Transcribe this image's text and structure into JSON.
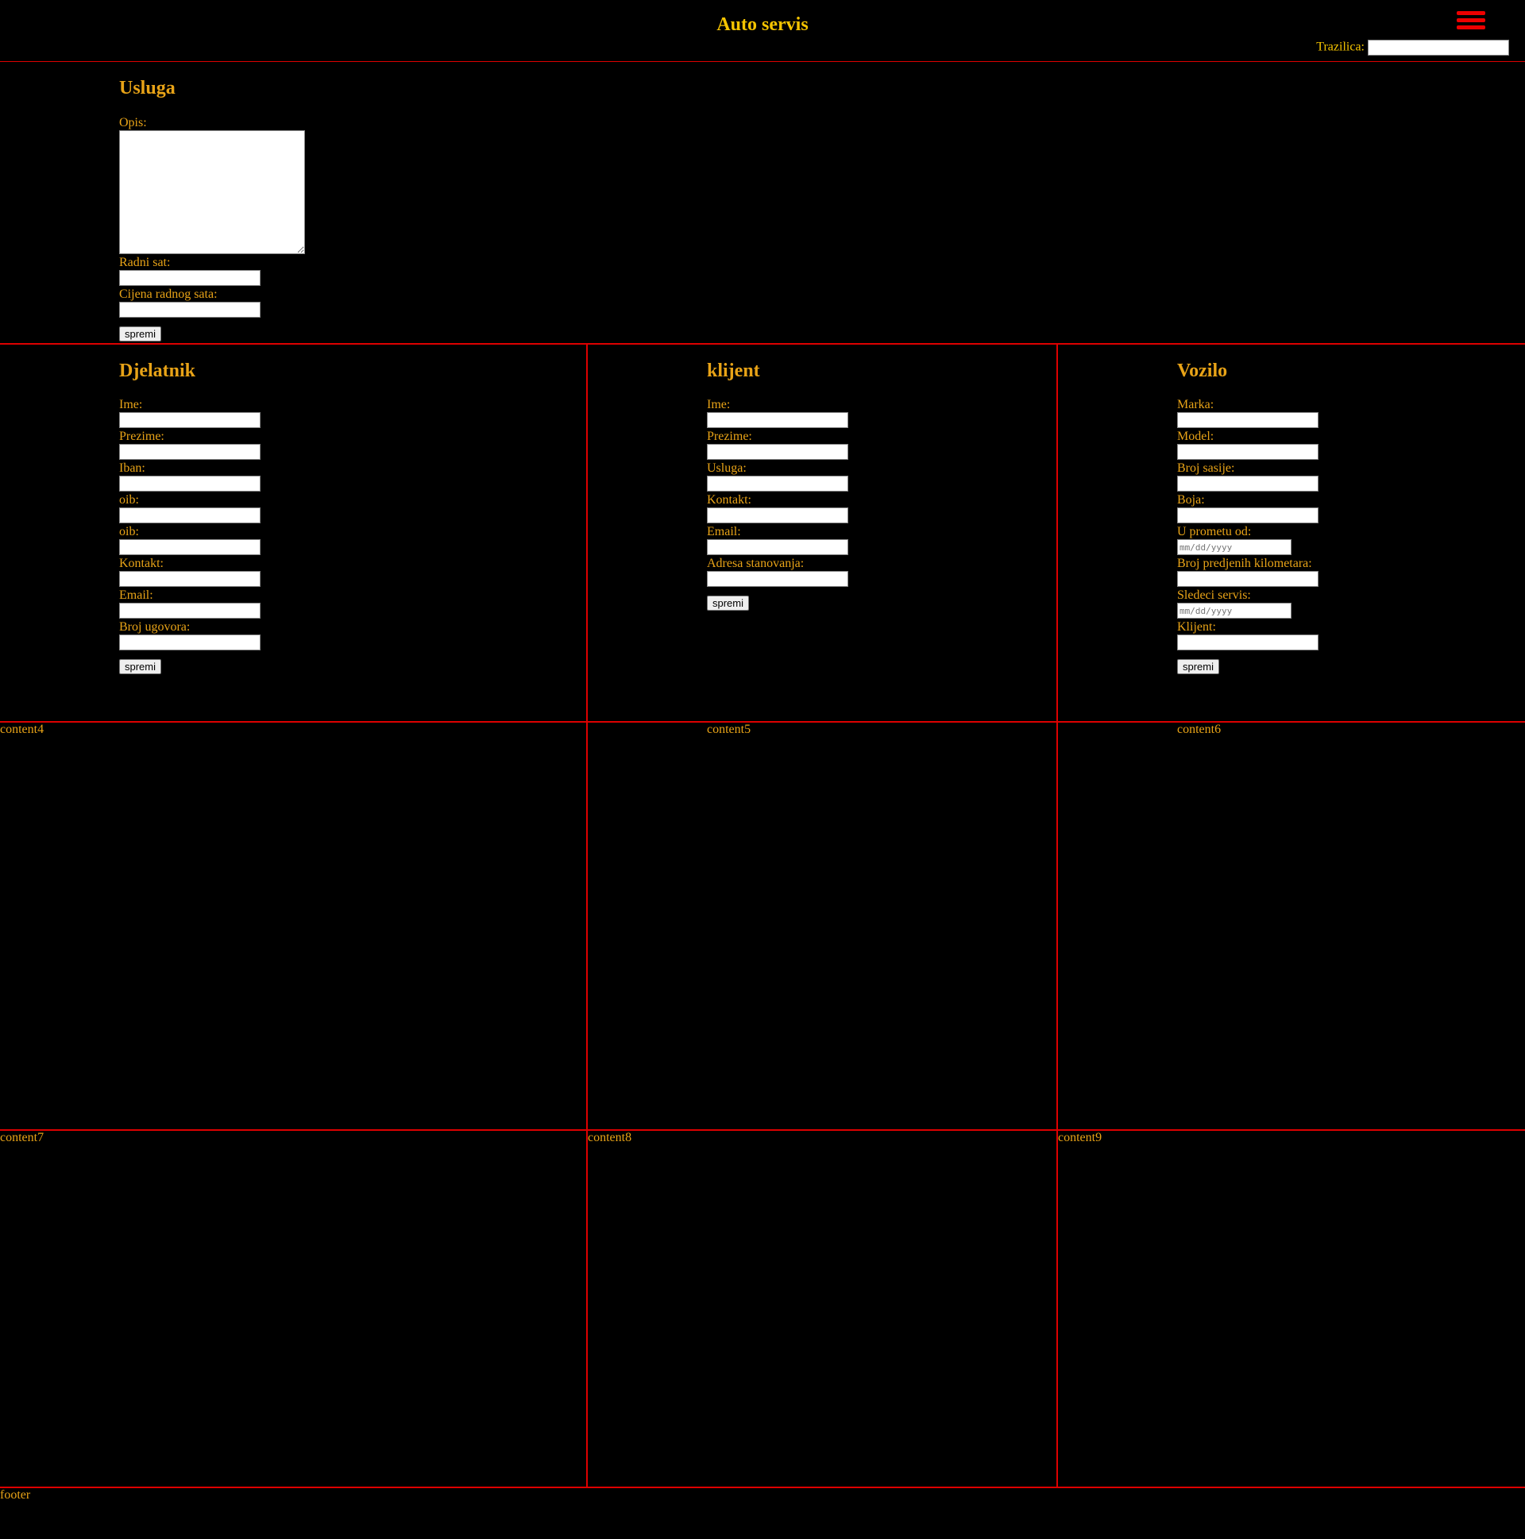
{
  "header": {
    "title": "Auto servis",
    "menu_icon": "hamburger-menu-icon",
    "search_label": "Trazilica:",
    "search_value": ""
  },
  "usluga": {
    "title": "Usluga",
    "fields": [
      "Opis:",
      "Radni sat:",
      "Cijena radnog sata:"
    ],
    "button": "spremi"
  },
  "djelatnik": {
    "title": "Djelatnik",
    "fields": [
      "Ime:",
      "Prezime:",
      "Iban:",
      "oib:",
      "oib:",
      "Kontakt:",
      "Email:",
      "Broj ugovora:"
    ],
    "button": "spremi"
  },
  "klijent": {
    "title": "klijent",
    "fields": [
      "Ime:",
      "Prezime:",
      "Usluga:",
      "Kontakt:",
      "Email:",
      "Adresa stanovanja:"
    ],
    "button": "spremi"
  },
  "vozilo": {
    "title": "Vozilo",
    "fields": [
      "Marka:",
      "Model:",
      "Broj sasije:",
      "Boja:",
      "U prometu od:",
      "Broj predjenih kilometara:",
      "Sledeci servis:",
      "Klijent:"
    ],
    "date_placeholder": "mm/dd/yyyy",
    "button": "spremi"
  },
  "placeholders": {
    "content4": "content4",
    "content5": "content5",
    "content6": "content6",
    "content7": "content7",
    "content8": "content8",
    "content9": "content9",
    "footer": "footer"
  },
  "colors": {
    "text": "#e8a317",
    "title": "#f5c400",
    "border": "#dd0000",
    "background": "#000000"
  }
}
